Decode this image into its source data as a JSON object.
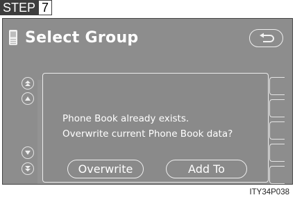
{
  "step": {
    "label": "STEP",
    "number": "7"
  },
  "screen": {
    "title": "Select Group",
    "icons": {
      "phone": "mobile-phone-icon",
      "back": "back-arrow-icon",
      "scroll_top": "double-up-arrow-icon",
      "scroll_up": "up-arrow-icon",
      "scroll_down": "down-arrow-icon",
      "scroll_bottom": "double-down-arrow-icon"
    }
  },
  "dialog": {
    "message_line1": "Phone Book already exists.",
    "message_line2": "Overwrite current Phone Book data?",
    "overwrite_label": "Overwrite",
    "add_to_label": "Add To"
  },
  "image_code": "ITY34P038"
}
